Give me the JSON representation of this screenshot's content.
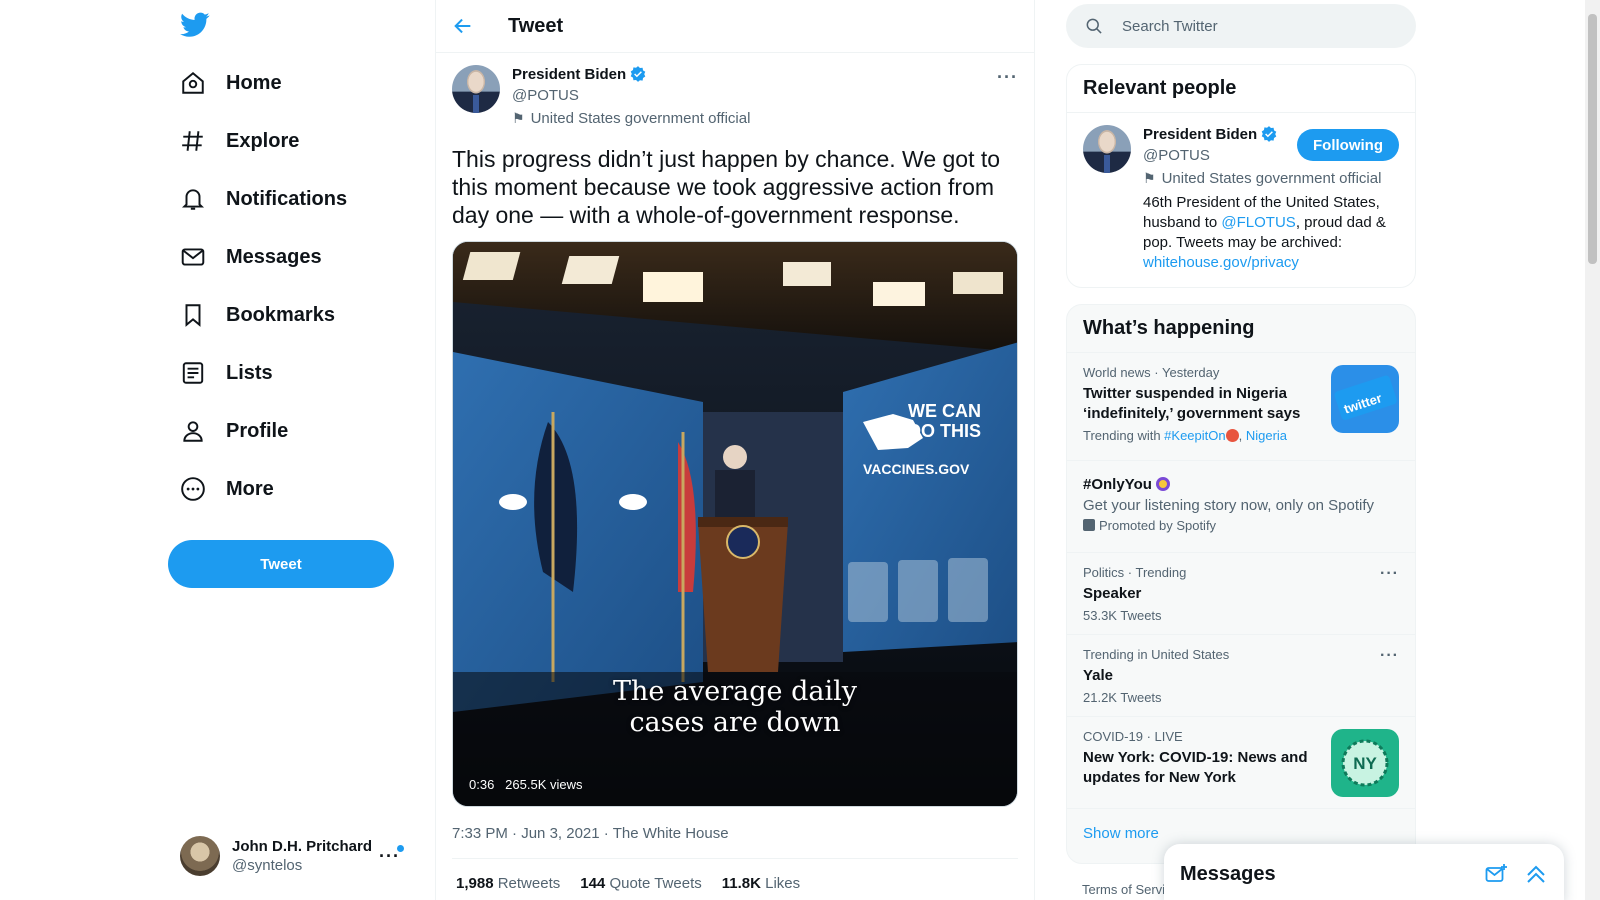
{
  "nav": {
    "items": [
      {
        "label": "Home",
        "icon": "home-icon"
      },
      {
        "label": "Explore",
        "icon": "hashtag-icon"
      },
      {
        "label": "Notifications",
        "icon": "bell-icon"
      },
      {
        "label": "Messages",
        "icon": "envelope-icon"
      },
      {
        "label": "Bookmarks",
        "icon": "bookmark-icon"
      },
      {
        "label": "Lists",
        "icon": "list-icon"
      },
      {
        "label": "Profile",
        "icon": "person-icon"
      },
      {
        "label": "More",
        "icon": "more-circle-icon"
      }
    ],
    "tweet_button": "Tweet",
    "account": {
      "name": "John D.H. Pritchard",
      "handle": "@syntelos",
      "more": "···"
    }
  },
  "main": {
    "title": "Tweet",
    "tweet": {
      "author_name": "President Biden",
      "author_handle": "@POTUS",
      "author_label": "United States government official",
      "text": "This progress didn’t just happen by chance. We got to this moment because we took aggressive action from day one — with a whole-of-government response.",
      "media": {
        "caption_line1": "The average daily",
        "caption_line2": "cases are down",
        "duration": "0:36",
        "views": "265.5K views",
        "banner_line1": "WE CAN",
        "banner_line2": "DO THIS",
        "banner_line3": "VACCINES.GOV"
      },
      "time": "7:33 PM",
      "date": "Jun 3, 2021",
      "source": "The White House",
      "retweets": "1,988",
      "retweets_label": "Retweets",
      "quotes": "144",
      "quotes_label": "Quote Tweets",
      "likes": "11.8K",
      "likes_label": "Likes",
      "more": "···"
    }
  },
  "right": {
    "search_placeholder": "Search Twitter",
    "relevant": {
      "title": "Relevant people",
      "name": "President Biden",
      "handle": "@POTUS",
      "label": "United States government official",
      "follow_label": "Following",
      "bio_part1": "46th President of the United States, husband to ",
      "bio_mention": "@FLOTUS",
      "bio_part2": ", proud dad & pop. Tweets may be archived: ",
      "bio_link": "whitehouse.gov/privacy"
    },
    "happening": {
      "title": "What’s happening",
      "trends": [
        {
          "meta": "World news · Yesterday",
          "title": "Twitter suspended in Nigeria ‘indefinitely,’ government says",
          "sub_prefix": "Trending with ",
          "tag1": "#KeepitOn",
          "tag2": "Nigeria"
        },
        {
          "title": "#OnlyYou",
          "desc": "Get your listening story now, only on Spotify",
          "promoted": "Promoted by Spotify"
        },
        {
          "meta": "Politics · Trending",
          "title": "Speaker",
          "sub": "53.3K Tweets",
          "more": "···"
        },
        {
          "meta": "Trending in United States",
          "title": "Yale",
          "sub": "21.2K Tweets",
          "more": "···"
        },
        {
          "meta": "COVID-19 · LIVE",
          "title": "New York: COVID-19: News and updates for New York",
          "thumb_text": "NY"
        }
      ],
      "twitter_thumb_text": "twitter",
      "show_more": "Show more"
    },
    "footer_terms": "Terms of Servi"
  },
  "messages_drawer": {
    "title": "Messages"
  },
  "colors": {
    "accent": "#1d9bf0",
    "text": "#0f1419",
    "muted": "#536471",
    "border": "#eff3f4"
  }
}
